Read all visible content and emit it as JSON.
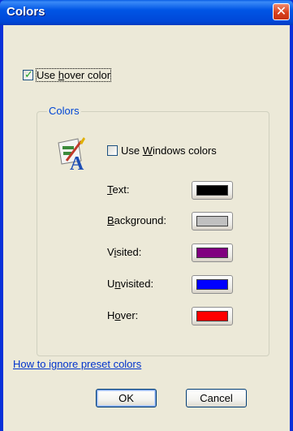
{
  "window": {
    "title": "Colors",
    "close_label": "✕"
  },
  "hover": {
    "label_pre": "Use ",
    "label_key": "h",
    "label_post": "over color",
    "checked": true
  },
  "group": {
    "title": "Colors",
    "windows_colors": {
      "label_pre": "Use ",
      "label_key": "W",
      "label_post": "indows colors",
      "checked": false
    },
    "fields": [
      {
        "key": "T",
        "rest": "ext:",
        "color": "#000000"
      },
      {
        "key": "B",
        "rest": "ackground:",
        "color": "#c0c0c0"
      },
      {
        "pre": "V",
        "key": "i",
        "rest": "sited:",
        "color": "#800080"
      },
      {
        "pre": "U",
        "key": "n",
        "rest": "visited:",
        "color": "#0000ff"
      },
      {
        "pre": "H",
        "key": "o",
        "rest": "ver:",
        "color": "#ff0000"
      }
    ]
  },
  "link_text": "How to ignore preset colors",
  "buttons": {
    "ok": "OK",
    "cancel": "Cancel"
  }
}
